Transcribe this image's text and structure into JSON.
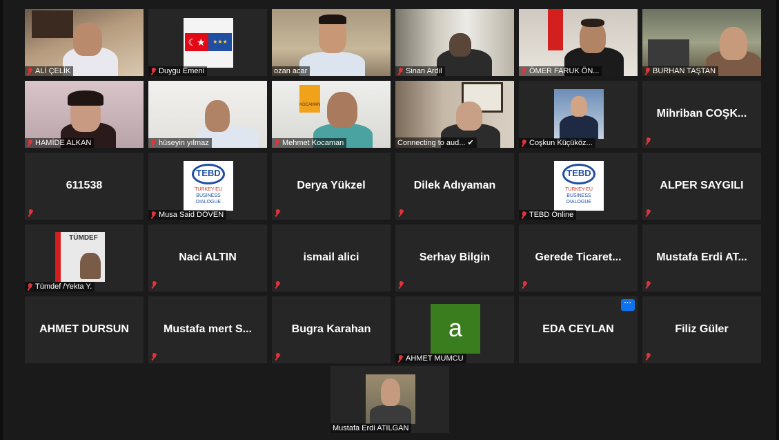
{
  "meeting": {
    "participants": [
      {
        "label": "ALİ ÇELİK",
        "kind": "video",
        "muted": true
      },
      {
        "label": "Duygu Emeni",
        "kind": "flag",
        "muted": true
      },
      {
        "label": "ozan acar",
        "kind": "video",
        "muted": false,
        "active_speaker": true
      },
      {
        "label": "Sinan Ardil",
        "kind": "video",
        "muted": true
      },
      {
        "label": "ÖMER FARUK ÖN...",
        "kind": "video",
        "muted": true
      },
      {
        "label": "BURHAN TAŞTAN",
        "kind": "video",
        "muted": true
      },
      {
        "label": "HAMİDE ALKAN",
        "kind": "video",
        "muted": true
      },
      {
        "label": "hüseyin yılmaz",
        "kind": "video",
        "muted": true
      },
      {
        "label": "Mehmet Kocaman",
        "kind": "video",
        "muted": true
      },
      {
        "label": "Connecting to aud...",
        "kind": "video",
        "muted": false,
        "connecting": true
      },
      {
        "label": "Coşkun Küçüköz...",
        "kind": "photo",
        "muted": true
      },
      {
        "name": "Mihriban COŞK...",
        "kind": "name",
        "muted": true
      },
      {
        "name": "611538",
        "kind": "name",
        "muted": true
      },
      {
        "label": "Musa Said DÖVEN",
        "kind": "tebd",
        "muted": true
      },
      {
        "name": "Derya Yükzel",
        "kind": "name",
        "muted": true
      },
      {
        "name": "Dilek Adıyaman",
        "kind": "name",
        "muted": true
      },
      {
        "label": "TEBD Online",
        "kind": "tebd",
        "muted": true
      },
      {
        "name": "ALPER SAYGILI",
        "kind": "name",
        "muted": true
      },
      {
        "label": "Tümdef /Yekta Y.",
        "kind": "tumdef",
        "muted": true
      },
      {
        "name": "Naci ALTIN",
        "kind": "name",
        "muted": true
      },
      {
        "name": "ismail alici",
        "kind": "name",
        "muted": true
      },
      {
        "name": "Serhay Bilgin",
        "kind": "name",
        "muted": true
      },
      {
        "name": "Gerede Ticaret...",
        "kind": "name",
        "muted": true
      },
      {
        "name": "Mustafa Erdi AT...",
        "kind": "name",
        "muted": true
      },
      {
        "name": "AHMET DURSUN",
        "kind": "name",
        "muted": false
      },
      {
        "name": "Mustafa mert S...",
        "kind": "name",
        "muted": true
      },
      {
        "name": "Bugra Karahan",
        "kind": "name",
        "muted": true
      },
      {
        "label": "AHMET MUMCU",
        "kind": "avatar",
        "avatar_letter": "a",
        "muted": true
      },
      {
        "name": "EDA CEYLAN",
        "kind": "name",
        "muted": false,
        "has_more_button": true
      },
      {
        "name": "Filiz Güler",
        "kind": "name",
        "muted": true
      },
      {
        "label": "Mustafa Erdi ATILGAN",
        "kind": "photo",
        "muted": false
      }
    ],
    "logos": {
      "tebd_text": "TEBD",
      "tebd_sub1": "TURKEY-EU",
      "tebd_sub2": "BUSINESS",
      "tebd_sub3": "DIALOGUE",
      "tumdef_text": "TÜMDEF",
      "kocaman_text": "KOCAMAN"
    },
    "more_button_label": "···",
    "colors": {
      "active_speaker": "#c9e16a",
      "muted_icon": "#e0343a",
      "tile_bg": "#262626",
      "avatar_bg": "#3a7d1e",
      "more_button": "#0e72ed"
    }
  }
}
